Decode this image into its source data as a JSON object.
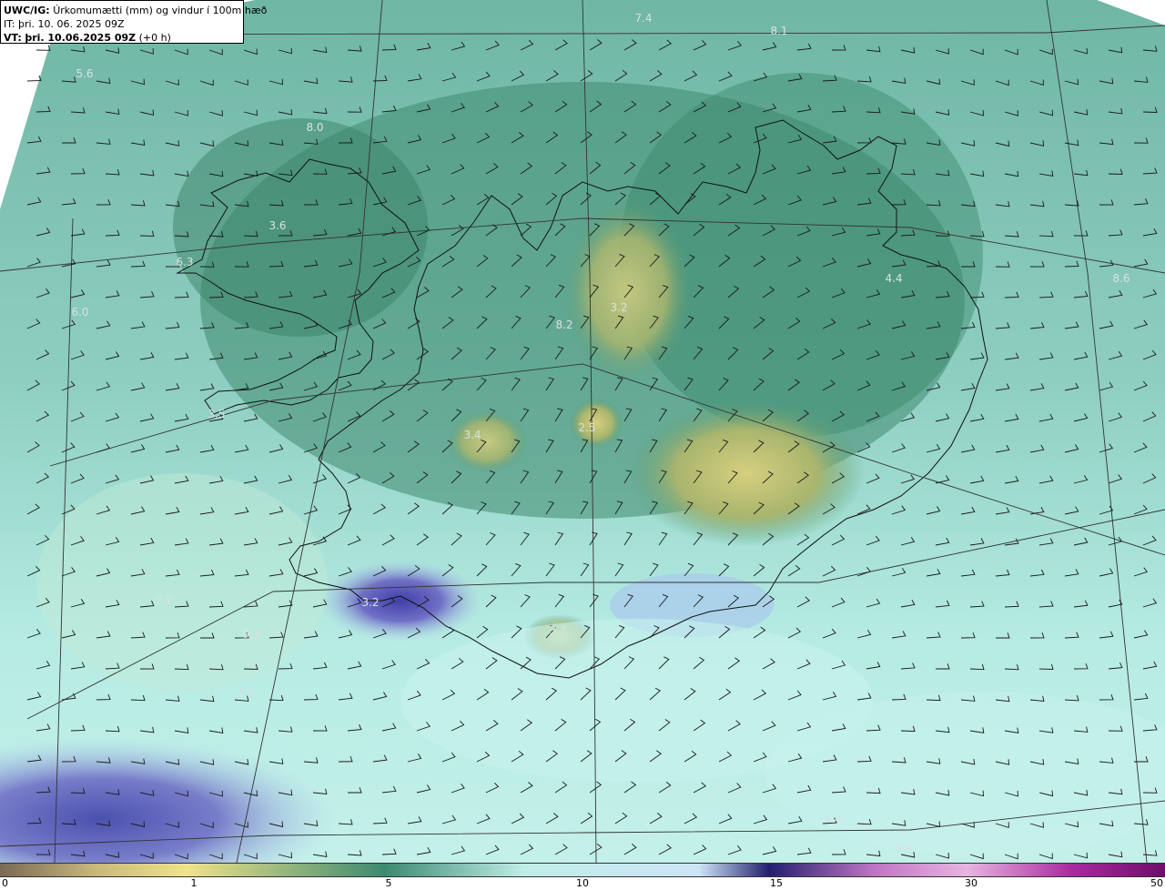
{
  "header": {
    "model": "UWC/IG:",
    "title": "Úrkomumætti (mm) og vindur í 100m hæð",
    "it": "IT: þri. 10. 06. 2025 09Z",
    "vt_label": "VT:",
    "vt_value": "þri. 10.06.2025 09Z",
    "vt_offset": "(+0 h)"
  },
  "colorbar": {
    "ticks": [
      "0",
      "1",
      "5",
      "10",
      "15",
      "30",
      "50"
    ],
    "colors": [
      "#7a6a55",
      "#c7b77a",
      "#f0e38a",
      "#3d8a70",
      "#bfeee7",
      "#cce4f7",
      "#23206e",
      "#c074c4",
      "#e8b4e0",
      "#aa2aa0",
      "#6e0d6a"
    ]
  },
  "map": {
    "station_values": [
      "7.4",
      "8.1",
      "5.6",
      "8.0",
      "3.6",
      "6.3",
      "6.0",
      "3.5",
      "3.4",
      "2.5",
      "3.2",
      "8.2",
      "4.4",
      "8.6",
      "3.2",
      "3.7",
      "7.2",
      "9.3",
      "7.4",
      "3.4",
      "9.4"
    ]
  }
}
